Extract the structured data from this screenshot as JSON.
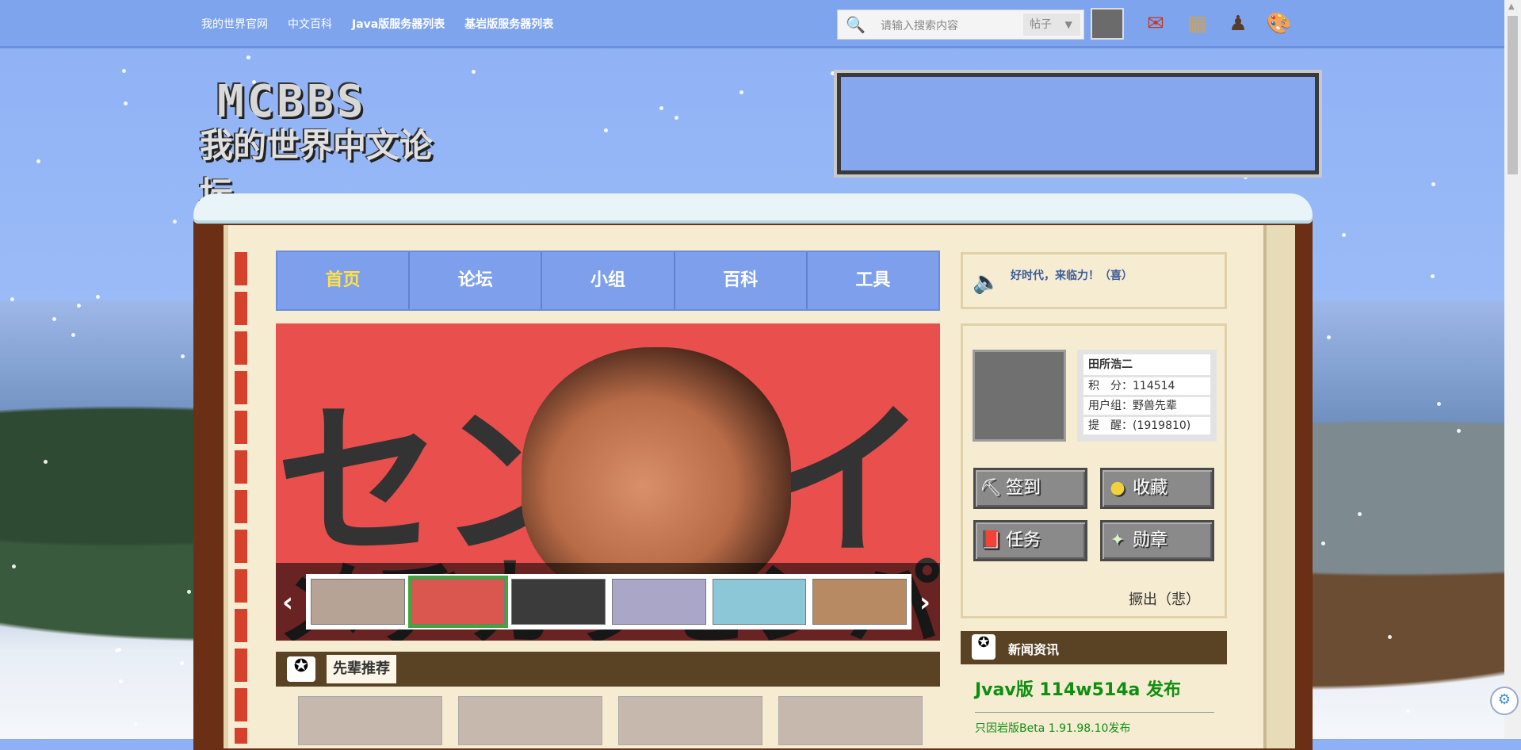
{
  "topbar": {
    "links": [
      "我的世界官网",
      "中文百科",
      "Java版服务器列表",
      "基岩版服务器列表"
    ],
    "search_placeholder": "请输入搜索内容",
    "search_type": "帖子",
    "search_type_arrow": "▼",
    "search_icon": "🔍",
    "icons": [
      "✉",
      "▦",
      "♟",
      "🎨"
    ]
  },
  "logo": {
    "line1": "MCBBS",
    "line2": "我的世界中文论坛"
  },
  "nav": {
    "items": [
      "首页",
      "论坛",
      "小组",
      "百科",
      "工具"
    ],
    "active": 0
  },
  "slideshow": {
    "headline": "センパイ",
    "subline": "メヂカラセンパイ",
    "prev": "‹",
    "next": "›",
    "thumb_count": 6,
    "selected_thumb": 1
  },
  "recommend": {
    "title": "先辈推荐"
  },
  "notice": {
    "text": "好时代，来临力！（喜）",
    "icon": "🔈"
  },
  "user": {
    "name": "田所浩二",
    "score": "积　分：114514",
    "group": "用户组：野兽先辈",
    "remind": "提　醒：(1919810)"
  },
  "buttons": {
    "signin": "签到",
    "signin_icon": "⛏",
    "favorite": "收藏",
    "favorite_icon": "●",
    "task": "任务",
    "task_icon": "📕",
    "medal": "勋章",
    "medal_icon": "✦"
  },
  "logout": "撅出（悲）",
  "news": {
    "title": "新闻资讯",
    "headline": "Jvav版 114w514a 发布",
    "sub": "只因岩版Beta 1.91.98.10发布"
  },
  "float_icon": "⚙",
  "colors": {
    "accent": "#7ea0ec",
    "nav_active": "#ffe04a",
    "news_green": "#0e8f10"
  }
}
